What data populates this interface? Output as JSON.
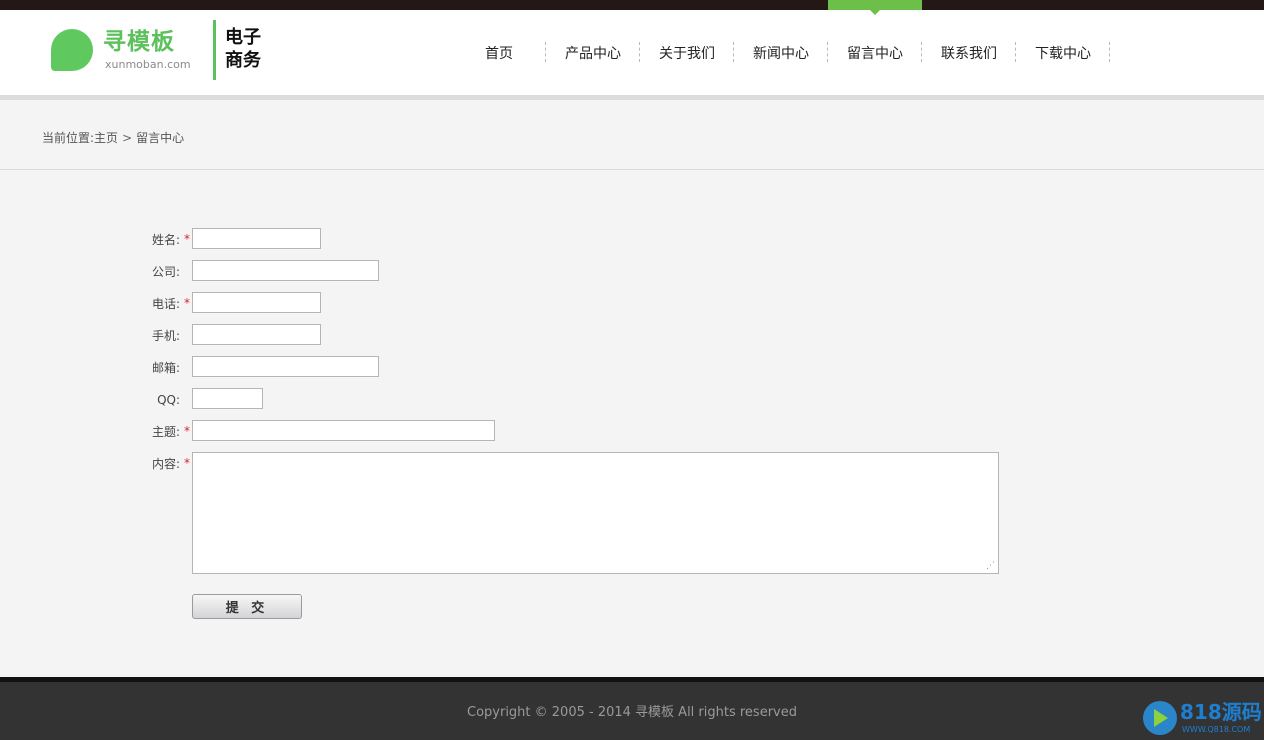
{
  "logo": {
    "name_cn": "寻模板",
    "domain": "xunmoban.com"
  },
  "site": {
    "name_line1": "电子",
    "name_line2": "商务"
  },
  "nav": {
    "items": [
      {
        "label": "首页"
      },
      {
        "label": "产品中心"
      },
      {
        "label": "关于我们"
      },
      {
        "label": "新闻中心"
      },
      {
        "label": "留言中心",
        "active": true
      },
      {
        "label": "联系我们"
      },
      {
        "label": "下载中心"
      }
    ]
  },
  "breadcrumb": {
    "prefix": "当前位置:",
    "home": "主页",
    "separator": ">",
    "current": "留言中心"
  },
  "form": {
    "required_mark": "*",
    "fields": {
      "name": {
        "label": "姓名:",
        "value": ""
      },
      "company": {
        "label": "公司:",
        "value": ""
      },
      "phone": {
        "label": "电话:",
        "value": ""
      },
      "mobile": {
        "label": "手机:",
        "value": ""
      },
      "email": {
        "label": "邮箱:",
        "value": ""
      },
      "qq": {
        "label": "QQ:",
        "value": ""
      },
      "subject": {
        "label": "主题:",
        "value": ""
      },
      "content": {
        "label": "内容:",
        "value": ""
      }
    },
    "submit_label": "提 交"
  },
  "footer": {
    "copyright": "Copyright © 2005 - 2014 寻模板 All rights reserved"
  },
  "watermark": {
    "text": "818源码",
    "url": "WWW.Q818.COM"
  },
  "colors": {
    "brand_green": "#5cc15c",
    "nav_active": "#6cc04a",
    "required": "#d9252a",
    "footer_bg": "#333333"
  }
}
